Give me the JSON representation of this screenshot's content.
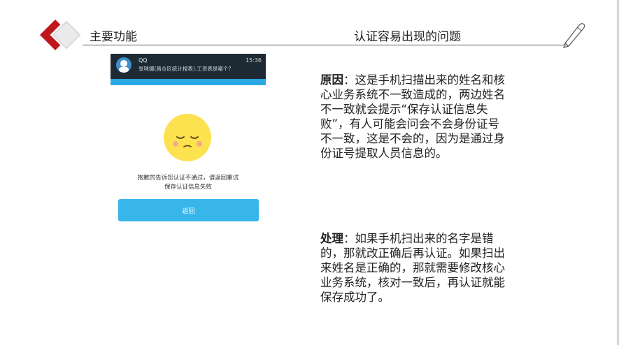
{
  "header": {
    "title": "主要功能",
    "topic": "认证容易出现的问题"
  },
  "phone": {
    "notification": {
      "app_name": "QQ",
      "time": "15:36",
      "message": "张咪娜(昌仓区统计报表):工资表是哪个?"
    },
    "error_line1": "抱歉的告诉您认证不通过，请返回重试",
    "error_line2": "保存认证信息失败",
    "back_button_label": "返回"
  },
  "content": {
    "reason_label": "原因",
    "reason_text": "：这是手机扫描出来的姓名和核心业务系统不一致造成的，两边姓名不一致就会提示“保存认证信息失败”，有人可能会问会不会身份证号不一致，这是不会的，因为是通过身份证号提取人员信息的。",
    "handling_label": "处理",
    "handling_text": "：如果手机扫出来的名字是错的，那就改正确后再认证。如果扫出来姓名是正确的，那就需要修改核心业务系统，核对一致后，再认证就能保存成功了。"
  },
  "colors": {
    "logo_red": "#c0161e",
    "button_blue": "#38b6ea",
    "notification_bg": "#1e2a33",
    "emoji_yellow": "#fde24f"
  }
}
